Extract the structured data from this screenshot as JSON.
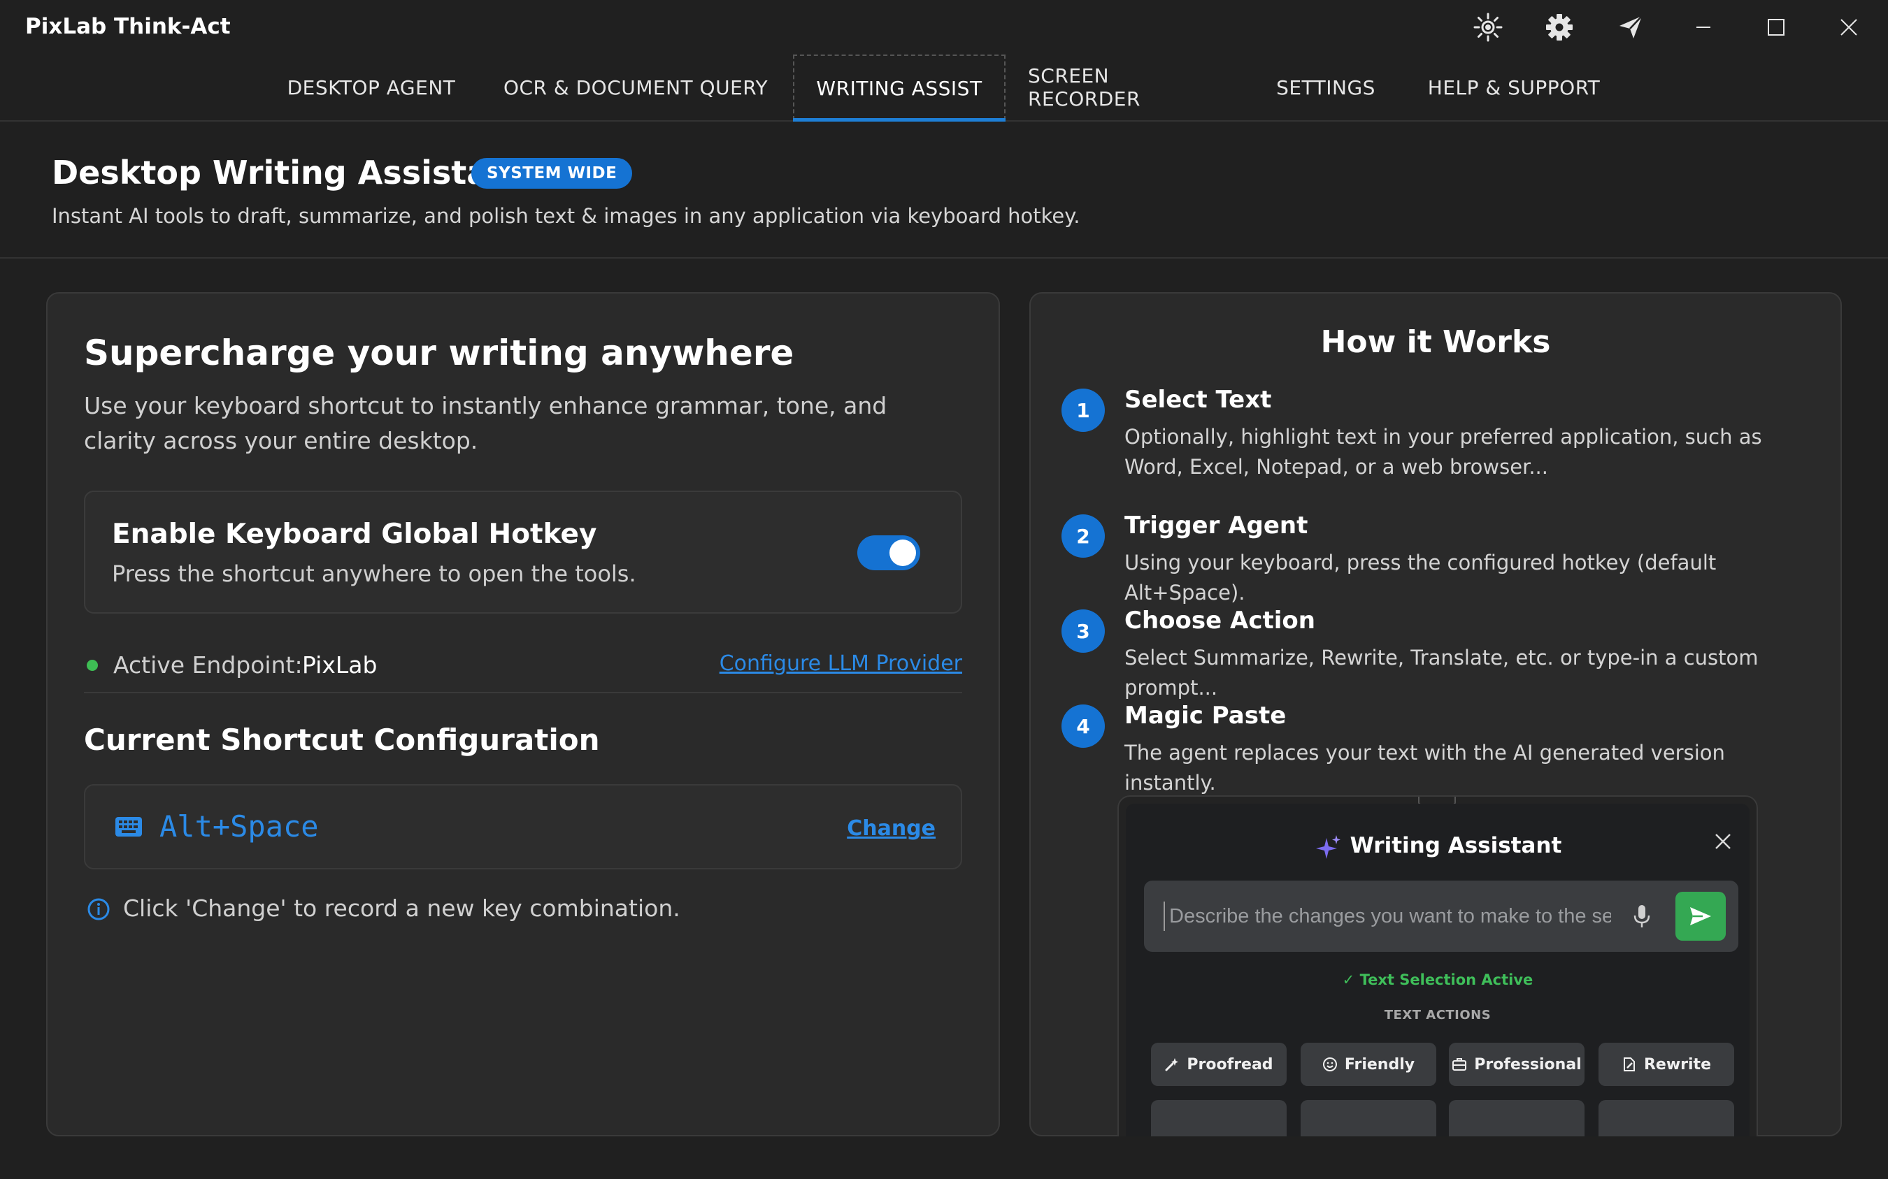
{
  "app": {
    "title": "PixLab Think-Act"
  },
  "titlebar": {
    "icons": [
      "theme-sun-icon",
      "gear-icon",
      "paper-plane-icon",
      "minimize-icon",
      "maximize-icon",
      "close-icon"
    ]
  },
  "nav": {
    "tabs": [
      {
        "label": "DESKTOP AGENT"
      },
      {
        "label": "OCR & DOCUMENT QUERY"
      },
      {
        "label": "WRITING ASSIST",
        "active": true
      },
      {
        "label": "SCREEN RECORDER"
      },
      {
        "label": "SETTINGS"
      },
      {
        "label": "HELP & SUPPORT"
      }
    ]
  },
  "header": {
    "title": "Desktop Writing Assistant",
    "badge": "SYSTEM WIDE",
    "subtitle": "Instant AI tools to draft, summarize, and polish text & images in any application via keyboard hotkey."
  },
  "left": {
    "title": "Supercharge your writing anywhere",
    "description": "Use your keyboard shortcut to instantly enhance grammar, tone, and clarity across your entire desktop.",
    "hotkey": {
      "title": "Enable Keyboard Global Hotkey",
      "description": "Press the shortcut anywhere to open the tools.",
      "enabled": true
    },
    "endpoint": {
      "label": "Active Endpoint:",
      "value": "PixLab",
      "status_color": "#3ebd54",
      "link": "Configure LLM Provider"
    },
    "shortcut": {
      "title": "Current Shortcut Configuration",
      "value": "Alt+Space",
      "change": "Change",
      "info": "Click 'Change' to record a new key combination."
    }
  },
  "right": {
    "title": "How it Works",
    "steps": [
      {
        "num": "1",
        "title": "Select Text",
        "desc": "Optionally, highlight text in your preferred application, such as Word, Excel, Notepad, or a web browser..."
      },
      {
        "num": "2",
        "title": "Trigger Agent",
        "desc": "Using your keyboard, press the configured hotkey (default Alt+Space)."
      },
      {
        "num": "3",
        "title": "Choose Action",
        "desc": "Select Summarize, Rewrite, Translate, etc. or type-in a custom prompt..."
      },
      {
        "num": "4",
        "title": "Magic Paste",
        "desc": "The agent replaces your text with the AI generated version instantly."
      }
    ],
    "preview": {
      "title": "Writing Assistant",
      "input_placeholder": "Describe the changes you want to make to the selected text",
      "selection_status": "✓ Text Selection Active",
      "actions_label": "TEXT ACTIONS",
      "actions": [
        {
          "label": "Proofread",
          "icon": "sparkle-wand-icon"
        },
        {
          "label": "Friendly",
          "icon": "smiley-icon"
        },
        {
          "label": "Professional",
          "icon": "briefcase-icon"
        },
        {
          "label": "Rewrite",
          "icon": "document-edit-icon"
        }
      ]
    }
  },
  "colors": {
    "accent": "#1573d3",
    "link": "#2b8ae6",
    "success": "#3ebd54",
    "send": "#34a853"
  }
}
